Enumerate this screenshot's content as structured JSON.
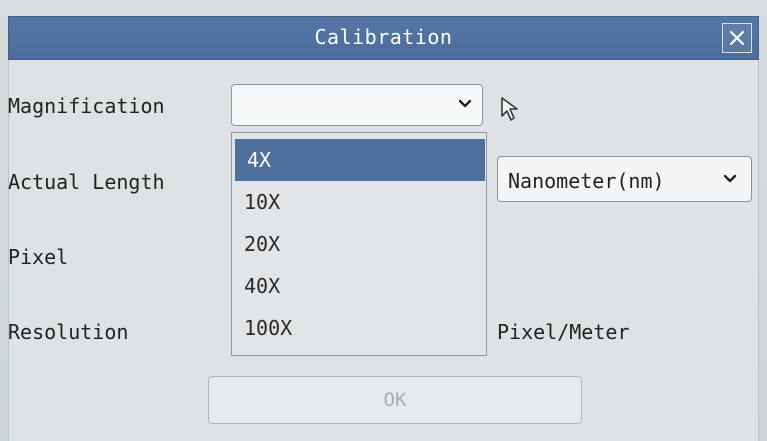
{
  "window": {
    "title": "Calibration"
  },
  "form": {
    "magnification_label": "Magnification",
    "actual_length_label": "Actual Length",
    "pixel_label": "Pixel",
    "resolution_label": "Resolution",
    "resolution_unit": "Pixel/Meter",
    "magnification_value": "",
    "unit_value": "Nanometer(nm)"
  },
  "dropdown": {
    "options": [
      "4X",
      "10X",
      "20X",
      "40X",
      "100X"
    ],
    "selected": "4X"
  },
  "buttons": {
    "ok_label": "OK"
  },
  "icons": {
    "close": "close-icon",
    "chevron": "chevron-down-icon",
    "cursor": "mouse-pointer-icon"
  },
  "colors": {
    "titlebar": "#5577a6",
    "selected_item": "#4f6f9c",
    "background": "#dde2e4"
  }
}
